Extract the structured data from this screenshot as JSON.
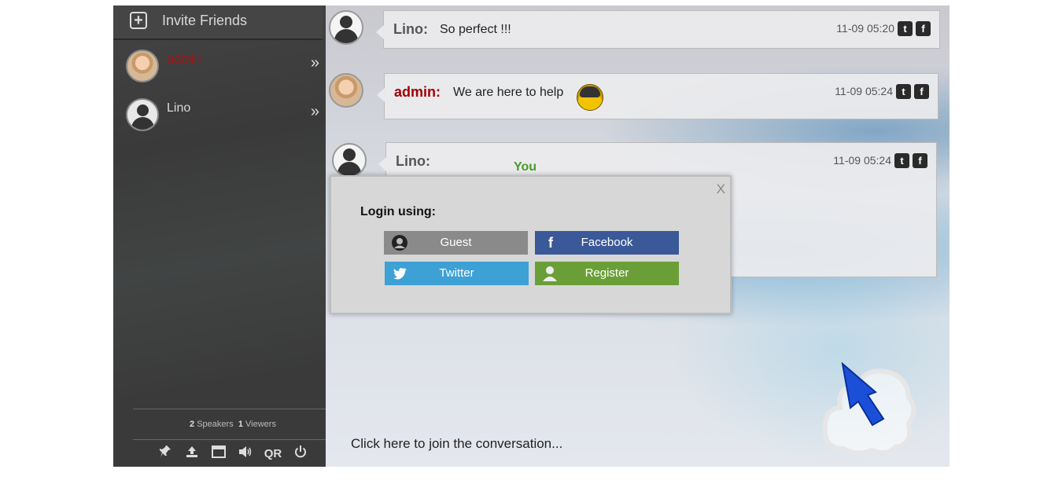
{
  "sidebar": {
    "invite_label": "Invite Friends",
    "users": [
      {
        "name": "admin",
        "color": "#b01010"
      },
      {
        "name": "Lino",
        "color": "#d8d8d8"
      }
    ],
    "chevron": "»",
    "stats": {
      "speakers_count": "2",
      "speakers_label": "Speakers",
      "viewers_count": "1",
      "viewers_label": "Viewers"
    },
    "tools": [
      "pin-icon",
      "upload-icon",
      "window-icon",
      "speaker-icon",
      "QR",
      "power-icon"
    ],
    "tools_qr_label": "QR"
  },
  "messages": [
    {
      "sender": "Lino:",
      "text": "So perfect !!!",
      "time": "11-09 05:20"
    },
    {
      "sender": "admin:",
      "text": "We are here to help",
      "time": "11-09 05:24"
    },
    {
      "sender": "Lino:",
      "text": "You",
      "time": "11-09 05:24"
    }
  ],
  "social_icons": {
    "twitter": "t",
    "facebook": "f"
  },
  "join_prompt": "Click here to join the conversation...",
  "login_modal": {
    "close": "X",
    "title": "Login using:",
    "buttons": {
      "guest": "Guest",
      "facebook": "Facebook",
      "twitter": "Twitter",
      "register": "Register"
    }
  },
  "colors": {
    "facebook": "#3b5998",
    "twitter": "#3da1d6",
    "register": "#6a9f37",
    "guest": "#8a8a8a",
    "admin_name": "#a10000"
  }
}
